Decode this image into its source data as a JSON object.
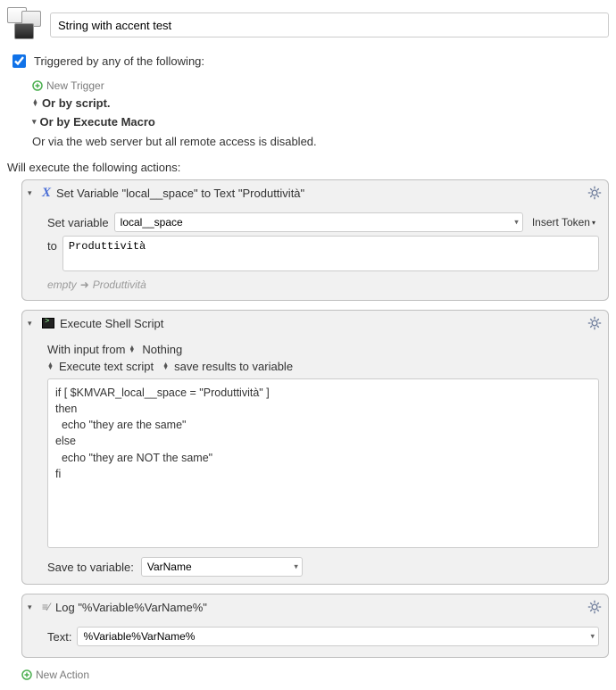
{
  "header": {
    "title": "String with accent test"
  },
  "trigger": {
    "checkbox_label": "Triggered by any of the following:",
    "new_trigger": "New Trigger",
    "or_script": "Or by script.",
    "or_execute_macro": "Or by Execute Macro",
    "or_web": "Or via the web server but all remote access is disabled."
  },
  "actions_label": "Will execute the following actions:",
  "action1": {
    "title": "Set Variable \"local__space\" to Text \"Produttività\"",
    "set_variable_label": "Set variable",
    "variable_name": "local__space",
    "insert_token": "Insert Token",
    "to_label": "to",
    "to_value": "Produttività",
    "summary_empty": "empty",
    "summary_result": "Produttività"
  },
  "action2": {
    "title": "Execute Shell Script",
    "input_prefix": "With input from",
    "input_value": "Nothing",
    "opt_execute": "Execute text script",
    "opt_save": "save results to variable",
    "script": "if [ $KMVAR_local__space = \"Produttività\" ]\nthen\n  echo \"they are the same\"\nelse\n  echo \"they are NOT the same\"\nfi",
    "save_label": "Save to variable:",
    "save_var": "VarName"
  },
  "action3": {
    "title": "Log \"%Variable%VarName%\"",
    "text_label": "Text:",
    "text_value": "%Variable%VarName%"
  },
  "new_action": "New Action"
}
